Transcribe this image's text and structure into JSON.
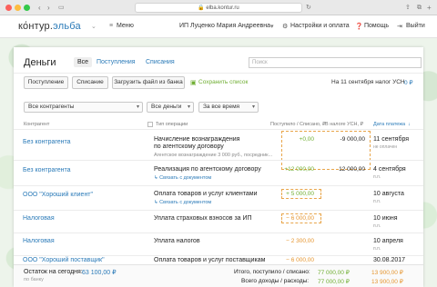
{
  "browser": {
    "url": "elba.kontur.ru"
  },
  "nav": {
    "logo_a": "кόнтур.",
    "logo_b": "эльба",
    "menu": "Меню",
    "company": "ИП Луценко Мария Андреевна",
    "settings": "Настройки и оплата",
    "help": "Помощь",
    "logout": "Выйти"
  },
  "page": {
    "title": "Деньги",
    "tabs": [
      "Все",
      "Поступления",
      "Списания"
    ],
    "search_placeholder": "Поиск"
  },
  "toolbar": {
    "income": "Поступление",
    "expense": "Списание",
    "upload": "Загрузить файл из банка",
    "save_list": "Сохранить список",
    "tax_note": "На 11 сентября налог УСН",
    "tax_value": "0 ₽"
  },
  "filters": {
    "contractor": "Все контрагенты",
    "money": "Все деньги",
    "period": "За все время"
  },
  "columns": {
    "contractor": "Контрагент",
    "operation": "Тип операции",
    "amount": "Поступило / Списано, ₽",
    "tax": "В налоге УСН, ₽",
    "date": "Дата платежа"
  },
  "rows": [
    {
      "contractor": "Без контрагента",
      "op1": "Начисление вознаграждения",
      "op2": "по агентскому договору",
      "sub": "Агентское вознаграждение 3 000 руб., посредник...",
      "amount": "+0,00",
      "tax": "-9 000,00",
      "date": "11 сентября",
      "date_sub": "не оплачен"
    },
    {
      "contractor": "Без контрагента",
      "op1": "Реализация по агентскому договору",
      "op2": "",
      "sub": "Связать с документом",
      "amount": "+12 000,00",
      "tax": "12 000,00",
      "date": "4 сентября",
      "date_sub": "п.п."
    },
    {
      "contractor": "ООО \"Хороший клиент\"",
      "op1": "Оплата товаров и услуг клиентами",
      "op2": "",
      "sub": "Связать с документом",
      "amount": "+ 5 000,00",
      "tax": "",
      "date": "10 августа",
      "date_sub": "п.п."
    },
    {
      "contractor": "Налоговая",
      "op1": "Уплата страховых взносов за ИП",
      "op2": "",
      "sub": "",
      "amount": "− 6 000,00",
      "tax": "",
      "date": "10 июня",
      "date_sub": "п.п."
    },
    {
      "contractor": "Налоговая",
      "op1": "Уплата налогов",
      "op2": "",
      "sub": "",
      "amount": "− 2 300,00",
      "tax": "",
      "date": "10 апреля",
      "date_sub": "п.п."
    },
    {
      "contractor": "ООО \"Хороший поставщик\"",
      "op1": "Оплата товаров и услуг поставщикам",
      "op2": "",
      "sub": "",
      "amount": "− 6 000,00",
      "tax": "",
      "date": "30.08.2017",
      "date_sub": ""
    }
  ],
  "footer": {
    "balance_label": "Остаток на сегодня:",
    "balance_value": "63 100,00 ₽",
    "balance_sub": "по банку",
    "total_label": "Итого, поступило / списано:",
    "total_in": "77 000,00 ₽",
    "total_out": "13 900,00 ₽",
    "all_label": "Всего доходы / расходы:",
    "all_in": "77 000,00 ₽",
    "all_out": "13 900,00 ₽"
  },
  "colors": {
    "accent": "#2a7ab8",
    "green": "#6fae32",
    "orange": "#e5952f"
  }
}
